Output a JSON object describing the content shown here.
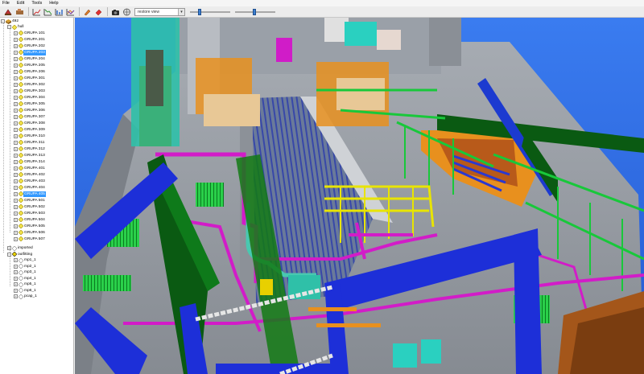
{
  "menu": [
    "File",
    "Edit",
    "Tools",
    "Help"
  ],
  "toolbar": {
    "view_select": "restore view",
    "slider1_level": 0.22,
    "slider2_level": 0.48
  },
  "tree": {
    "root": "492",
    "hull": "hull",
    "groups": [
      "GRUPA 101",
      "GRUPA 201",
      "GRUPA 202",
      "GRUPA 203",
      "GRUPA 204",
      "GRUPA 205",
      "GRUPA 206",
      "GRUPA 301",
      "GRUPA 302",
      "GRUPA 303",
      "GRUPA 304",
      "GRUPA 305",
      "GRUPA 306",
      "GRUPA 307",
      "GRUPA 308",
      "GRUPA 309",
      "GRUPA 310",
      "GRUPA 311",
      "GRUPA 312",
      "GRUPA 313",
      "GRUPA 314",
      "GRUPA 401",
      "GRUPA 402",
      "GRUPA 403",
      "GRUPA 404",
      "GRUPA 405",
      "GRUPA 501",
      "GRUPA 502",
      "GRUPA 503",
      "GRUPA 504",
      "GRUPA 505",
      "GRUPA 506",
      "GRUPA 507"
    ],
    "selected": [
      "GRUPA 203",
      "GRUPA 405"
    ],
    "imported": "imported",
    "outfitting": "outfitting",
    "outfitting_items": [
      "mp1_1",
      "mp2_1",
      "mp3_1",
      "mp4_1",
      "mp5_1",
      "mp6_1",
      "pcap_1"
    ]
  },
  "colors": {
    "sky": "#2f6fe0",
    "deck": "#9aa0a8",
    "pipe_magenta": "#d21cc8",
    "pipe_yellow": "#e8e400",
    "pipe_green": "#18c83a",
    "rail_blue": "#1d2fd8",
    "orange": "#e8901e",
    "teal": "#2fc0a8",
    "dark_green": "#0a5a12",
    "selection": "#3399ff"
  }
}
